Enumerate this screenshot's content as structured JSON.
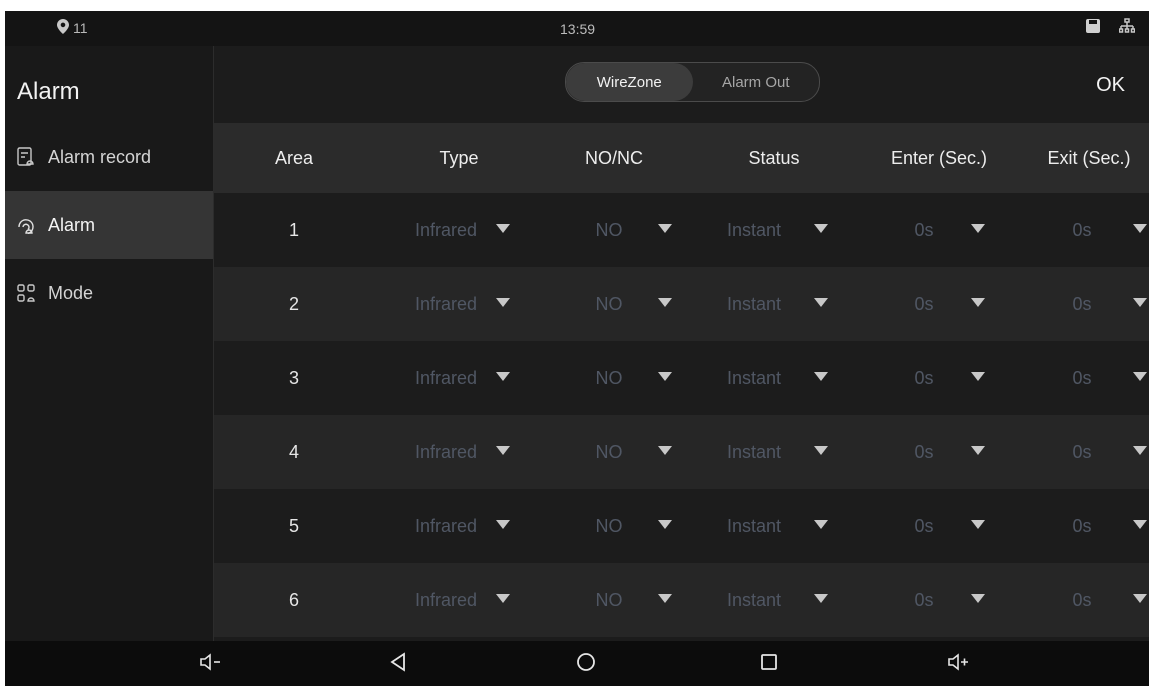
{
  "status": {
    "location_count": "11",
    "time": "13:59"
  },
  "sidebar": {
    "title": "Alarm",
    "items": [
      {
        "label": "Alarm record",
        "icon": "alarm-record-icon"
      },
      {
        "label": "Alarm",
        "icon": "alarm-icon",
        "active": true
      },
      {
        "label": "Mode",
        "icon": "mode-icon"
      }
    ]
  },
  "tabs": [
    {
      "label": "WireZone",
      "active": true
    },
    {
      "label": "Alarm Out",
      "active": false
    }
  ],
  "ok_label": "OK",
  "table": {
    "headers": [
      "Area",
      "Type",
      "NO/NC",
      "Status",
      "Enter (Sec.)",
      "Exit (Sec.)"
    ],
    "rows": [
      {
        "area": "1",
        "type": "Infrared",
        "nonc": "NO",
        "status": "Instant",
        "enter": "0s",
        "exit": "0s"
      },
      {
        "area": "2",
        "type": "Infrared",
        "nonc": "NO",
        "status": "Instant",
        "enter": "0s",
        "exit": "0s"
      },
      {
        "area": "3",
        "type": "Infrared",
        "nonc": "NO",
        "status": "Instant",
        "enter": "0s",
        "exit": "0s"
      },
      {
        "area": "4",
        "type": "Infrared",
        "nonc": "NO",
        "status": "Instant",
        "enter": "0s",
        "exit": "0s"
      },
      {
        "area": "5",
        "type": "Infrared",
        "nonc": "NO",
        "status": "Instant",
        "enter": "0s",
        "exit": "0s"
      },
      {
        "area": "6",
        "type": "Infrared",
        "nonc": "NO",
        "status": "Instant",
        "enter": "0s",
        "exit": "0s"
      }
    ]
  },
  "colors": {
    "accent_active_tab": "#3c3c3c",
    "disabled_text": "#505764"
  }
}
